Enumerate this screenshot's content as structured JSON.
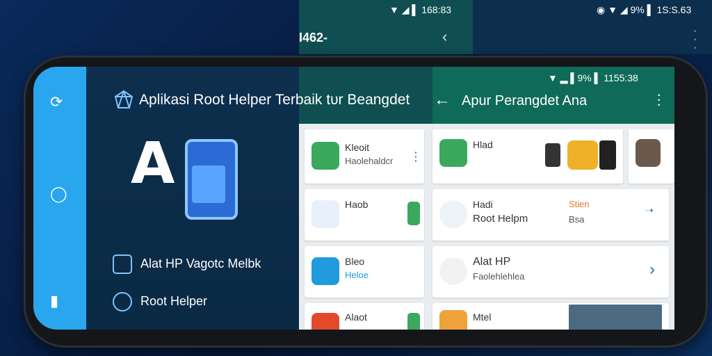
{
  "background": {
    "status_top": "▼ ◢ ▌ 168:83",
    "status_right": "◉ ▼ ◢ 9% ▌ 1S:S.63",
    "title_fragment": "I462-",
    "back_icon": "chevron-left-icon",
    "more_icon": "vertical-dots-icon"
  },
  "left_panel": {
    "app_title": "Aplikasi Root Helper Terbaik tυr Beangdet",
    "logo_letter": "A",
    "menu_items": [
      {
        "label": "Alat HP Vagotc Melbk",
        "icon": "tools-icon"
      },
      {
        "label": "Root Helper",
        "icon": "check-circle-icon"
      }
    ]
  },
  "navigation": {
    "icons": [
      "share-icon",
      "home-circle-icon",
      "recent-apps-icon"
    ]
  },
  "right_header": {
    "status": "▼ ▂ ▌9% ▌ 1155:38",
    "title": "Apur Perangdet Ana",
    "back_icon": "back-arrow-icon",
    "menu_icon": "more-vertical-icon"
  },
  "cards_mid": [
    {
      "title": "Kleoit",
      "subtitle": "Haolehaldcr",
      "icon": "tablet-green-icon"
    },
    {
      "title": "Haob",
      "subtitle": "",
      "icon": "gear-blue-icon"
    },
    {
      "title": "Bleo",
      "subtitle": "Heloe",
      "icon": "shield-blue-icon"
    },
    {
      "title": "Alaot",
      "subtitle": "",
      "icon": "gear-red-icon"
    }
  ],
  "cards_right": [
    {
      "title": "Hlad",
      "subtitle": "",
      "icon": "phone-green-icon"
    },
    {
      "title": "Hadi",
      "subtitle": "Root Helpm",
      "extra": [
        "Stien",
        "Bsa"
      ],
      "icon": "globe-icon"
    },
    {
      "title": "Alat HP",
      "subtitle": "Faolehlehlea",
      "icon": "magnifier-icon"
    },
    {
      "title": "Mtel",
      "subtitle": "",
      "icon": "tile-orange-icon"
    }
  ]
}
